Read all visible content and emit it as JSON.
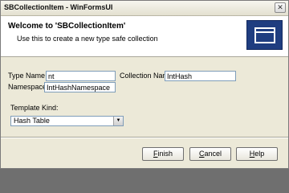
{
  "window": {
    "title": "SBCollectionItem - WinFormsUI",
    "close_glyph": "✕"
  },
  "header": {
    "title": "Welcome to 'SBCollectionItem'",
    "subtitle": "Use this to create a new type safe collection",
    "icon": "window-icon"
  },
  "form": {
    "type_name_label": "Type Name",
    "type_name_value": "nt",
    "collection_name_label": "Collection Name",
    "collection_name_value": "IntHash",
    "namespace_label": "Namespace",
    "namespace_value": "IntHashNamespace",
    "template_kind_label": "Template Kind:",
    "template_kind_value": "Hash Table"
  },
  "buttons": {
    "finish": {
      "mnemonic": "F",
      "rest": "inish"
    },
    "cancel": {
      "mnemonic": "C",
      "rest": "ancel"
    },
    "help": {
      "mnemonic": "H",
      "rest": "elp"
    }
  }
}
